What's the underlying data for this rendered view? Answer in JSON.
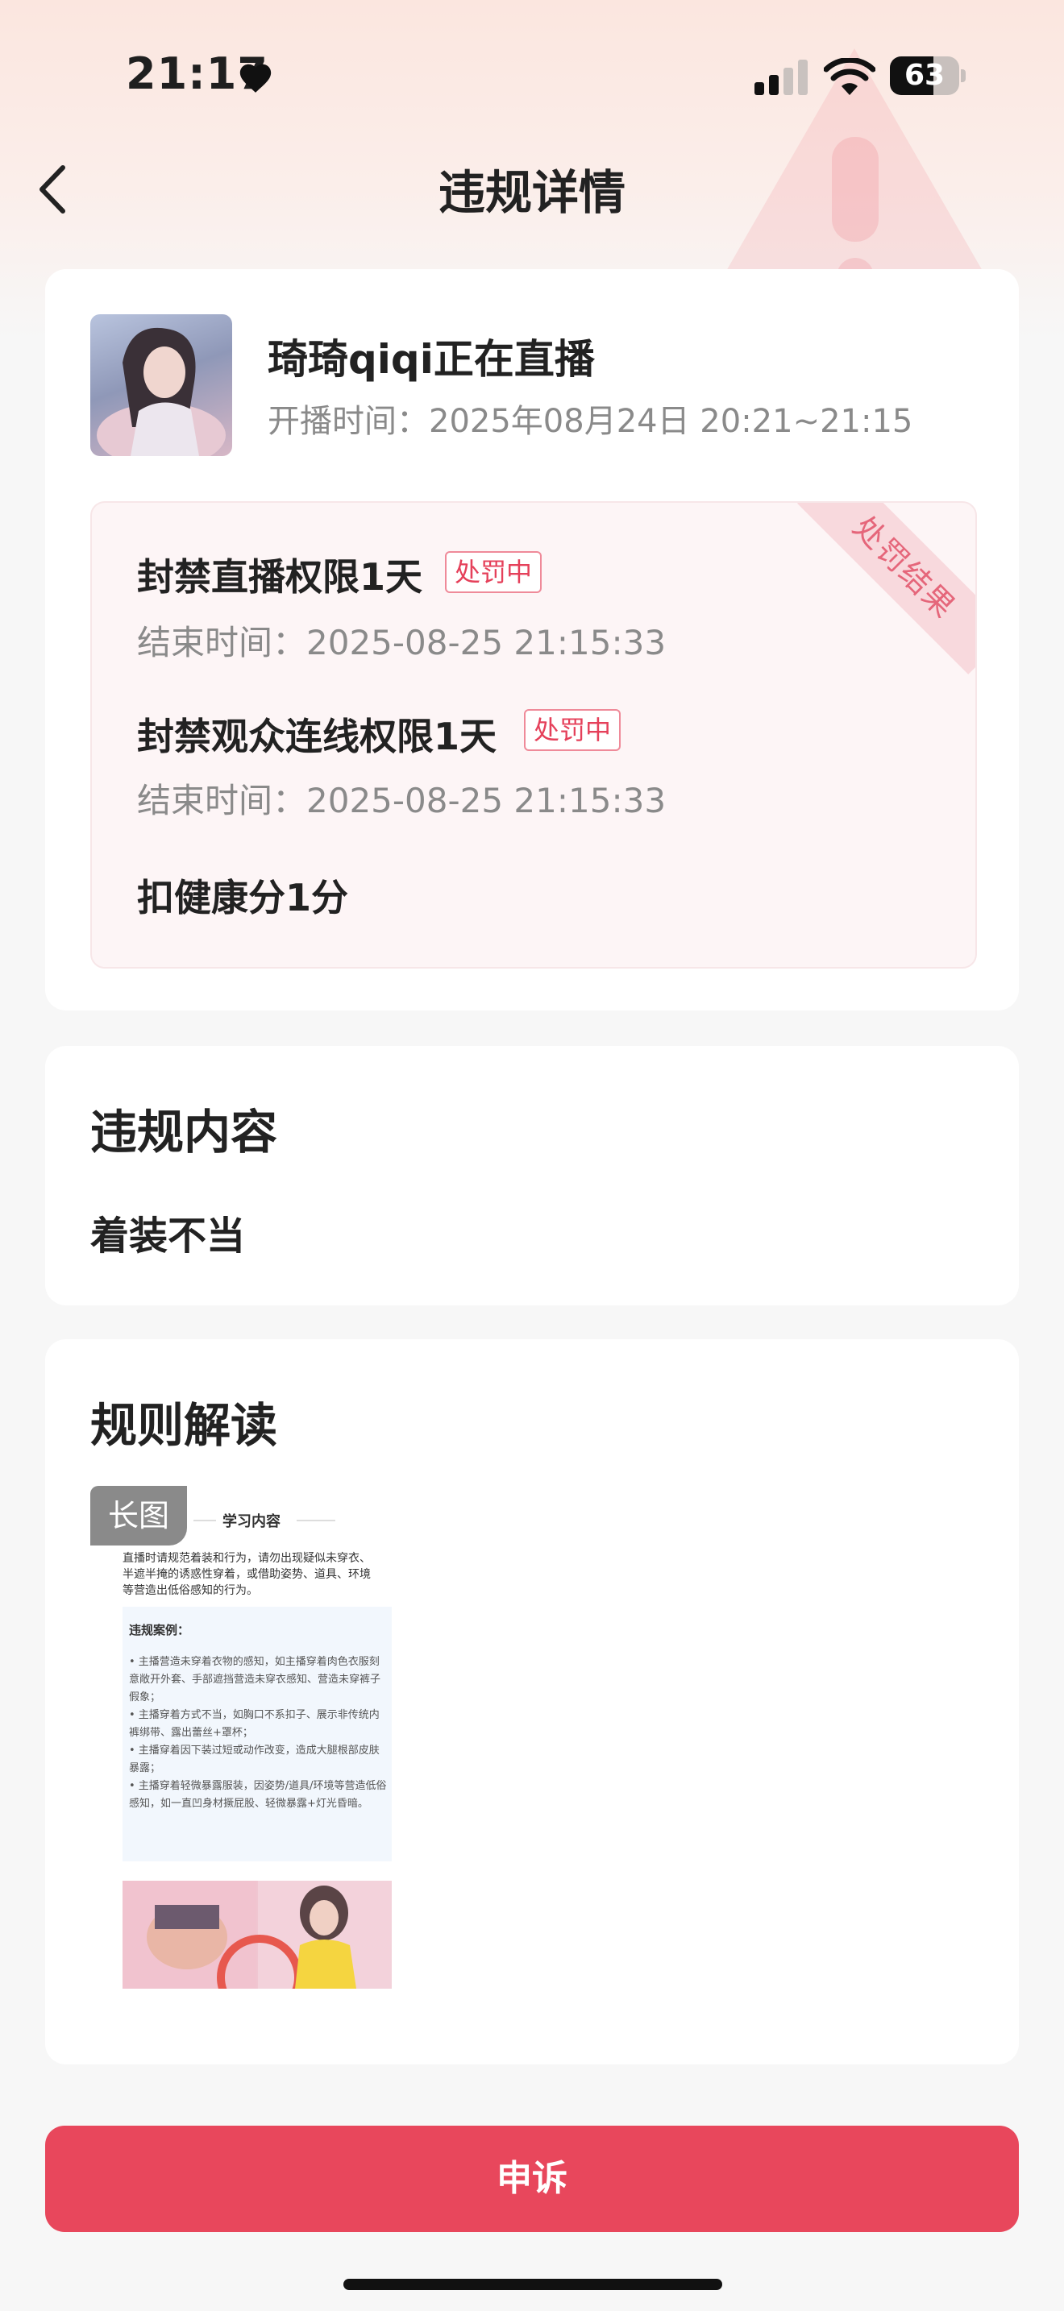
{
  "status_bar": {
    "time": "21:17",
    "battery": "63",
    "battery_fraction": 0.63
  },
  "nav": {
    "title": "违规详情"
  },
  "anchor": {
    "name": "琦琦qiqi正在直播",
    "live_time": "开播时间：2025年08月24日 20:21~21:15"
  },
  "penalty": {
    "ribbon": "处罚结果",
    "items": [
      {
        "title": "封禁直播权限1天",
        "badge": "处罚中",
        "end_time": "结束时间：2025-08-25 21:15:33"
      },
      {
        "title": "封禁观众连线权限1天",
        "badge": "处罚中",
        "end_time": "结束时间：2025-08-25 21:15:33"
      },
      {
        "title": "扣健康分1分"
      }
    ]
  },
  "violation": {
    "title": "违规内容",
    "content": "着装不当"
  },
  "rules": {
    "title": "规则解读",
    "image": {
      "tag": "长图",
      "heading": "学习内容",
      "intro": "直播时请规范着装和行为，请勿出现疑似未穿衣、半遮半掩的诱惑性穿着，或借助姿势、道具、环境等营造出低俗感知的行为。",
      "cases_title": "违规案例：",
      "cases": [
        "• 主播营造未穿着衣物的感知，如主播穿着肉色衣服刻意敞开外套、手部遮挡营造未穿衣感知、营造未穿裤子假象；",
        "• 主播穿着方式不当，如胸口不系扣子、展示非传统内裤绑带、露出蕾丝+罩杯；",
        "• 主播穿着因下装过短或动作改变，造成大腿根部皮肤暴露；",
        "• 主播穿着轻微暴露服装，因姿势/道具/环境等营造低俗感知，如一直凹身材撅屁股、轻微暴露+灯光昏暗。"
      ]
    }
  },
  "appeal_button": "申诉"
}
